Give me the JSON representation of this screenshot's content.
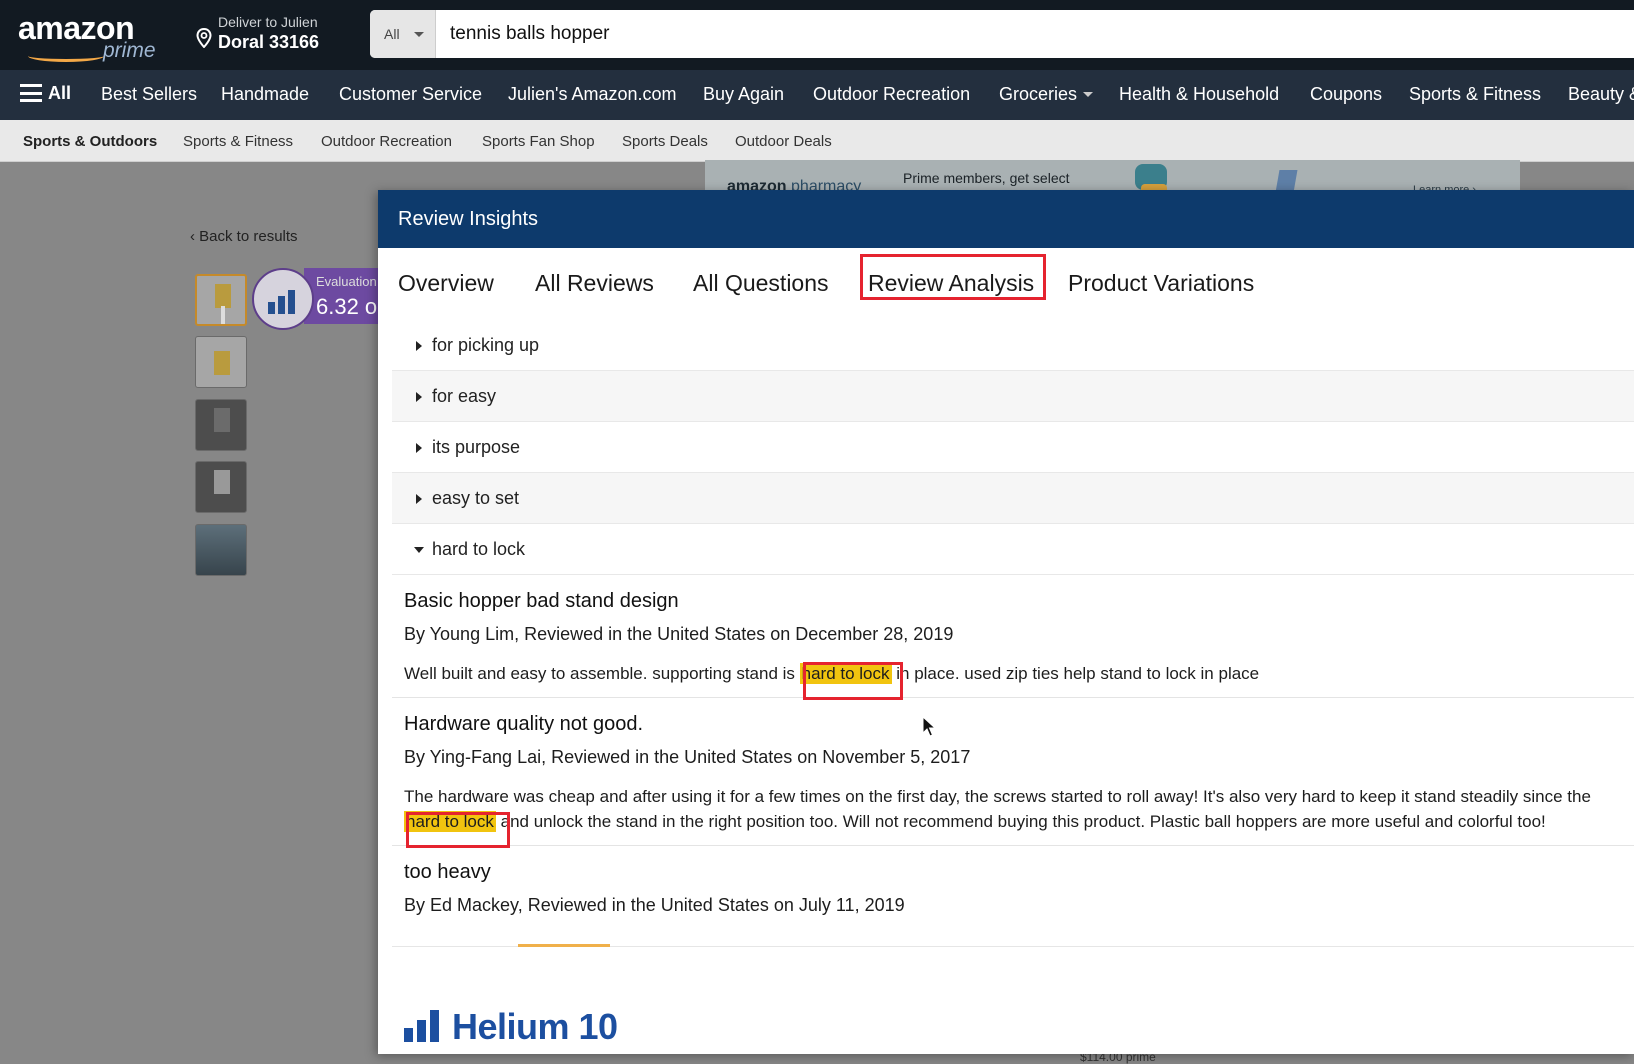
{
  "header": {
    "logo_text": "amazon",
    "logo_sub": "prime",
    "deliver_line1": "Deliver to Julien",
    "deliver_line2": "Doral 33166",
    "search_dept": "All",
    "search_value": "tennis balls hopper",
    "icons": [
      "location-pin-icon",
      "menu-icon",
      "caret-down-icon"
    ]
  },
  "nav": {
    "all_label": "All",
    "items": [
      "Best Sellers",
      "Handmade",
      "Customer Service",
      "Julien's Amazon.com",
      "Buy Again",
      "Outdoor Recreation",
      "Groceries",
      "Health & Household",
      "Coupons",
      "Sports & Fitness",
      "Beauty &"
    ]
  },
  "subnav": {
    "items": [
      "Sports & Outdoors",
      "Sports & Fitness",
      "Outdoor Recreation",
      "Sports Fan Shop",
      "Sports Deals",
      "Outdoor Deals"
    ]
  },
  "background_page": {
    "ad_logo": "amazon",
    "ad_logo_sub": "pharmacy",
    "ad_text": "Prime members, get select",
    "ad_more": "Learn more ›",
    "back_link": "‹ Back to results",
    "eval_label": "Evaluation",
    "eval_value": "6.32 o",
    "price_hint": "$114.00 prime"
  },
  "modal": {
    "title": "Review Insights",
    "tabs": [
      "Overview",
      "All Reviews",
      "All Questions",
      "Review Analysis",
      "Product Variations"
    ],
    "active_tab": "Review Analysis",
    "topics": [
      "for picking up",
      "for easy",
      "its purpose",
      "easy to set",
      "hard to lock"
    ],
    "expanded_topic": "hard to lock",
    "reviews": [
      {
        "title": "Basic hopper bad stand design",
        "byline": "By Young Lim, Reviewed in the United States on December 28, 2019",
        "text_before": "Well built and easy to assemble. supporting stand is ",
        "highlight": "hard to lock",
        "text_after": " in place. used zip ties help stand to lock in place"
      },
      {
        "title": "Hardware quality not good.",
        "byline": "By Ying-Fang Lai, Reviewed in the United States on November 5, 2017",
        "line1": "The hardware was cheap and after using it for a few times on the first day, the screws started to roll away! It's also very hard to keep it stand steadily since the",
        "highlight": "hard to lock",
        "line2_after": " and unlock the stand in the right position too. Will not recommend buying this product. Plastic ball hoppers are more useful and colorful too!"
      },
      {
        "title": "too heavy",
        "byline": "By Ed Mackey, Reviewed in the United States on July 11, 2019"
      }
    ],
    "brand": "Helium 10",
    "highlight_color": "#f1c40f",
    "header_color": "#0d3a6c",
    "accent_red": "#e5232f"
  }
}
